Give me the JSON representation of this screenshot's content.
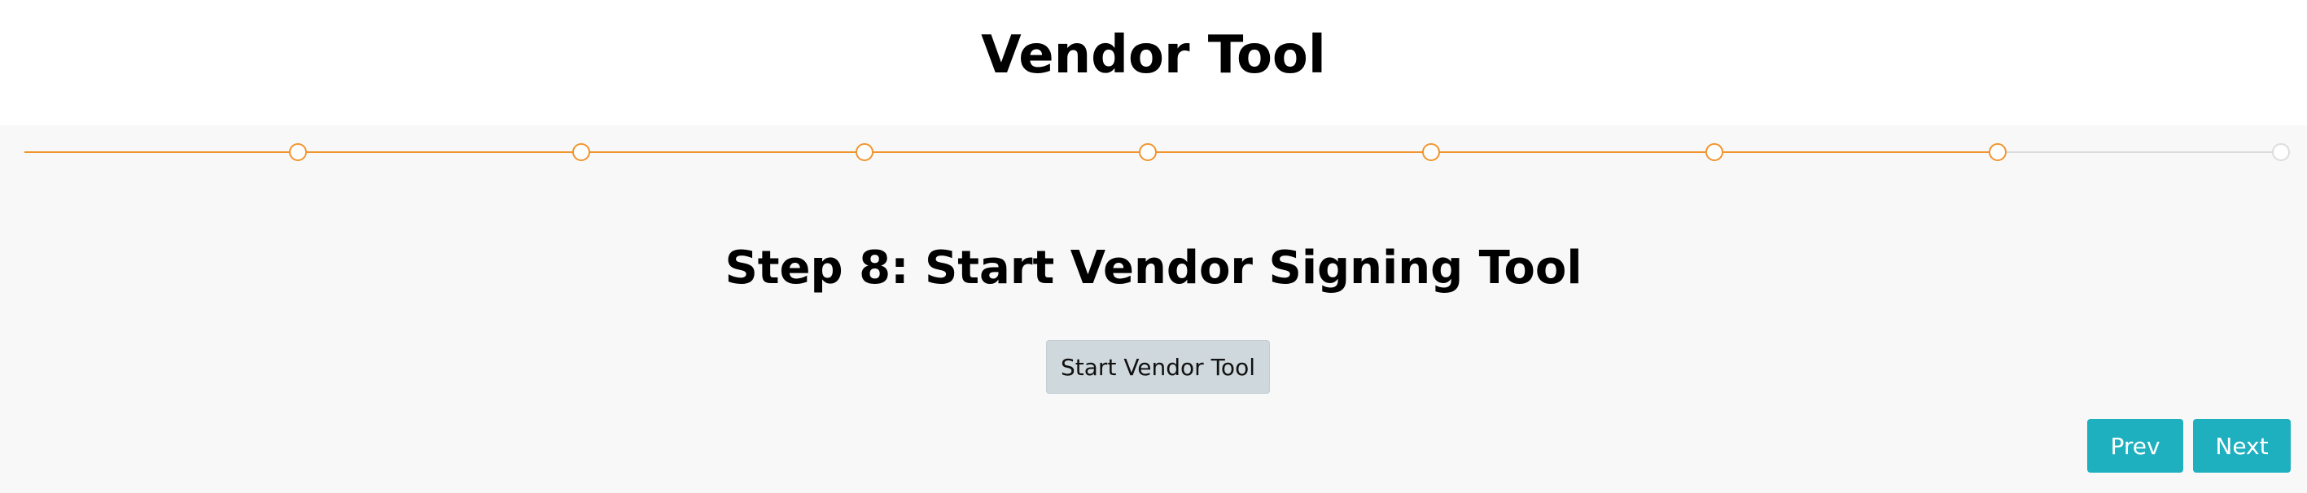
{
  "header": {
    "title": "Vendor Tool"
  },
  "stepper": {
    "total_steps": 8,
    "completed_steps": 7,
    "colors": {
      "active": "#f0952e",
      "inactive": "#dcdcdc"
    }
  },
  "step": {
    "heading": "Step 8: Start Vendor Signing Tool"
  },
  "actions": {
    "start_label": "Start Vendor Tool"
  },
  "navigation": {
    "prev_label": "Prev",
    "next_label": "Next"
  }
}
